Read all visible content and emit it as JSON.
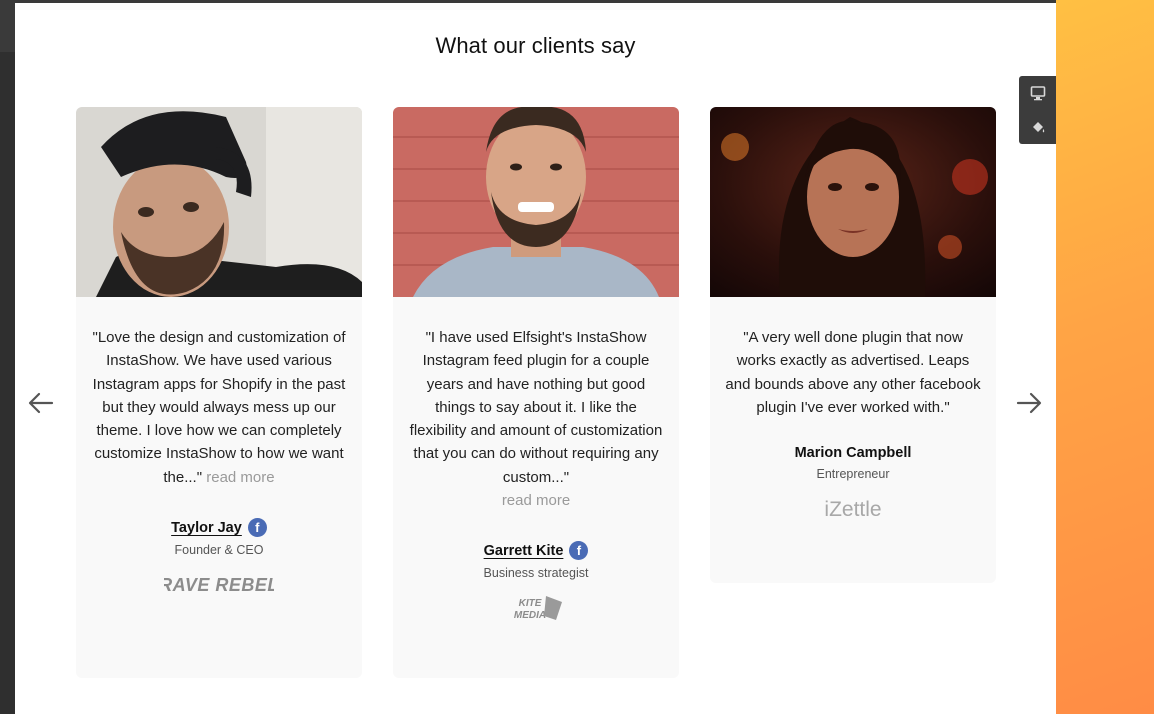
{
  "section": {
    "title": "What our clients say"
  },
  "testimonials": [
    {
      "quote": "\"Love the design and customization of InstaShow. We have used various Instagram apps for Shopify in the past but they would always mess up our theme. I love how we can completely customize InstaShow to how we want the...\"",
      "more": "read more",
      "name": "Taylor Jay",
      "role": "Founder & CEO",
      "logo_text": "RAVE REBEL",
      "photo_icon": "man-with-cap-photo"
    },
    {
      "quote": "\"I have used Elfsight's InstaShow Instagram feed plugin for a couple years and have nothing but good things to say about it. I like the flexibility and amount of customization that you can do without requiring any custom...\"",
      "more": "read more",
      "name": "Garrett Kite",
      "role": "Business strategist",
      "logo_text_top": "KITE",
      "logo_text_bottom": "MEDIA",
      "photo_icon": "smiling-man-photo"
    },
    {
      "quote": "\"A very well done plugin that now works exactly as advertised. Leaps and bounds above any other facebook plugin I've ever worked with.\"",
      "name": "Marion Campbell",
      "role": "Entrepreneur",
      "logo_text": "iZettle",
      "photo_icon": "woman-portrait-photo"
    }
  ],
  "social": {
    "facebook_glyph": "f"
  },
  "colors": {
    "facebook_badge": "#4a6bb5",
    "card_bg": "#f9f9f9",
    "right_gradient_top": "#ffc043",
    "right_gradient_bottom": "#ff8c45"
  },
  "icons": {
    "prev": "arrow-left-icon",
    "next": "arrow-right-icon",
    "tool_1": "monitor-icon",
    "tool_2": "paint-bucket-icon"
  }
}
